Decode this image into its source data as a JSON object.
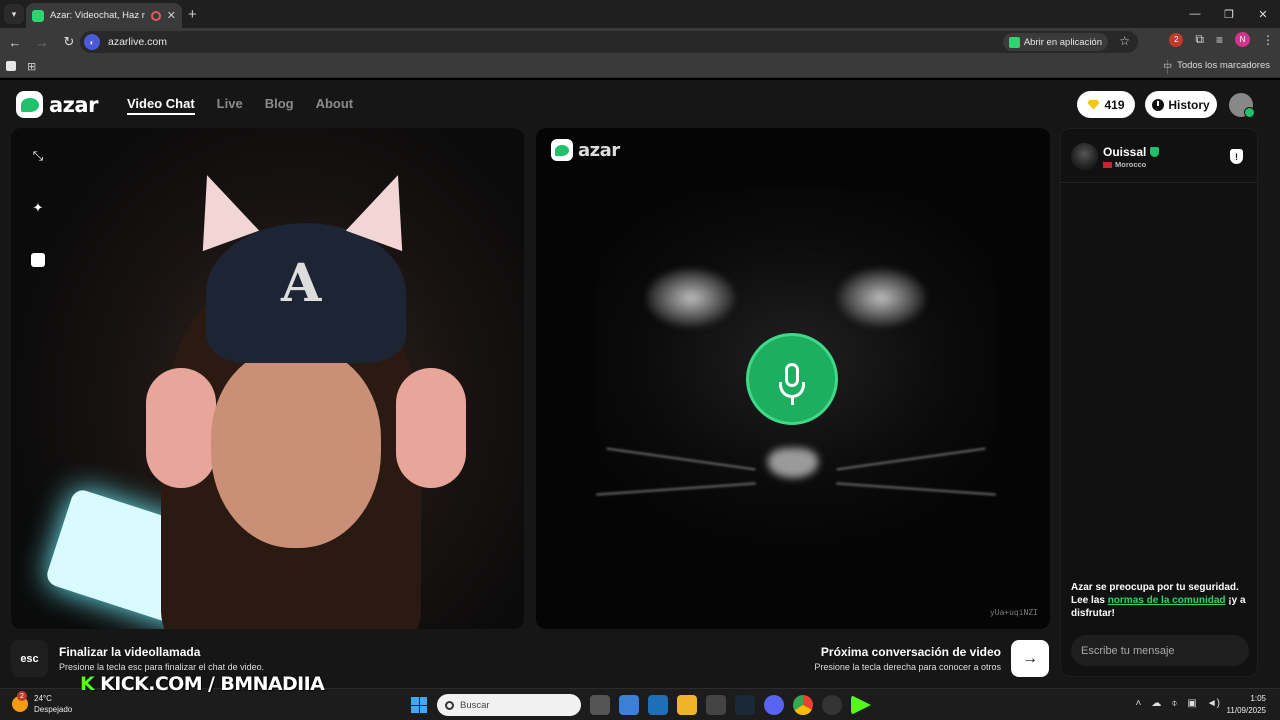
{
  "browser": {
    "tab_title": "Azar: Videochat, Haz nuevo",
    "tab_close": "✕",
    "new_tab": "+",
    "url": "azarlive.com",
    "open_in_app": "Abrir en aplicación",
    "profile_initial": "N",
    "extension_badge": "2",
    "all_bookmarks": "Todos los marcadores",
    "icons": [
      "back-icon",
      "forward-icon",
      "reload-icon",
      "star-icon",
      "extensions-icon",
      "menu-icon"
    ]
  },
  "header": {
    "logo_text": "azar",
    "nav": [
      "Video Chat",
      "Live",
      "Blog",
      "About"
    ],
    "active_nav": "Video Chat",
    "gems": "419",
    "history_label": "History"
  },
  "partner_video": {
    "logo_text": "azar",
    "watermark": "yUa+uqiNZI"
  },
  "chat": {
    "partner_name": "Ouissal",
    "partner_country": "Morocco",
    "report_symbol": "!",
    "safety_prefix": "Azar se preocupa por tu seguridad. Lee las ",
    "safety_link": "normas de la comunidad",
    "safety_suffix": " ¡y a disfrutar!",
    "message_placeholder": "Escribe tu mensaje"
  },
  "hints": {
    "esc_key": "esc",
    "end_title": "Finalizar la videollamada",
    "end_sub": "Presione la tecla esc para finalizar el chat de video.",
    "next_title": "Próxima conversación de video",
    "next_sub": "Presione la tecla derecha para conocer a otros",
    "next_arrow": "→"
  },
  "overlay": {
    "kick_k": "K",
    "kick_text": " KICK.COM / BMNADIIA"
  },
  "taskbar": {
    "weather_badge": "2",
    "temperature": "24°C",
    "weather": "Despejado",
    "search_placeholder": "Buscar",
    "time": "1:05",
    "date": "11/09/2025"
  },
  "colors": {
    "brand_green": "#1fc26b",
    "link_green": "#2bd66f",
    "kick_green": "#53fc18"
  }
}
